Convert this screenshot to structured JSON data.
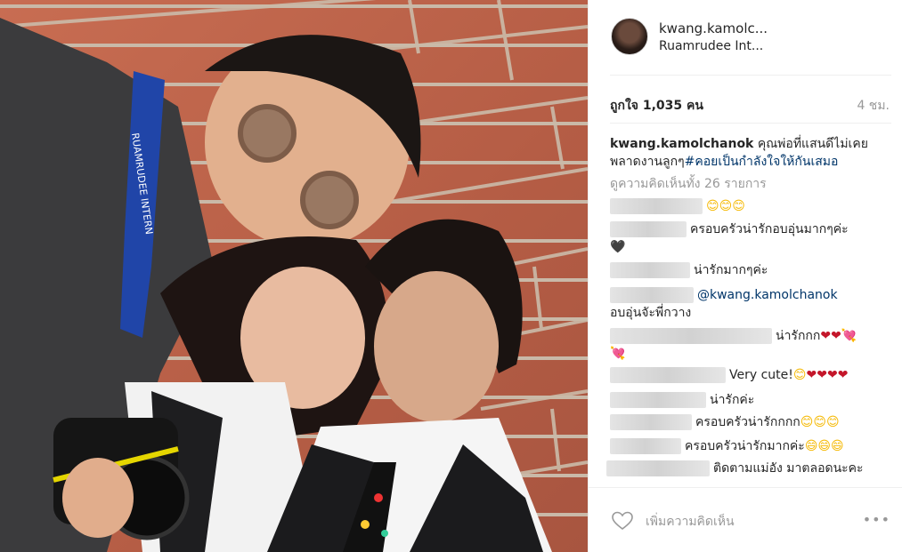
{
  "post": {
    "username": "kwang.kamolc...",
    "location": "Ruamrudee Int...",
    "likes": "ถูกใจ 1,035 คน",
    "time": "4 ชม.",
    "caption_user": "kwang.kamolchanok",
    "caption_text": " คุณพ่อที่แสนดีไม่เคยพลาดงานลูกๆ",
    "caption_tag": "#คอยเป็นกำลังใจให้กันเสมอ",
    "view_all": "ดูความคิดเห็นทั้ง 26 รายการ",
    "add_comment_placeholder": "เพิ่มความคิดเห็น",
    "more_icon": "•••"
  },
  "comments": [
    {
      "text": "😊😊😊"
    },
    {
      "text": "ครอบครัวน่ารักอบอุ่นมากๆค่ะ",
      "text2": "🖤"
    },
    {
      "text": "น่ารักมากๆค่ะ"
    },
    {
      "mention": "@kwang.kamolchanok",
      "text2": "อบอุ่นจัะพี่กวาง"
    },
    {
      "text": "น่ารักกก",
      "hearts": "❤❤💘",
      "text2": "💘"
    },
    {
      "text": "Very cute!",
      "emo": "😊",
      "hearts": "❤❤❤❤"
    },
    {
      "text": "น่ารักค่ะ"
    },
    {
      "text": "ครอบครัวน่ารักกกก",
      "emo": "😊😊😊"
    },
    {
      "text": "ครอบครัวน่ารักมากค่ะ",
      "emo": "😄😄😄"
    },
    {
      "text": "ติดตามแม่อัง มาตลอดนะคะ",
      "text2": "😍"
    }
  ],
  "photo": {
    "lanyard_text": "RUAMRUDEE INTERN"
  }
}
